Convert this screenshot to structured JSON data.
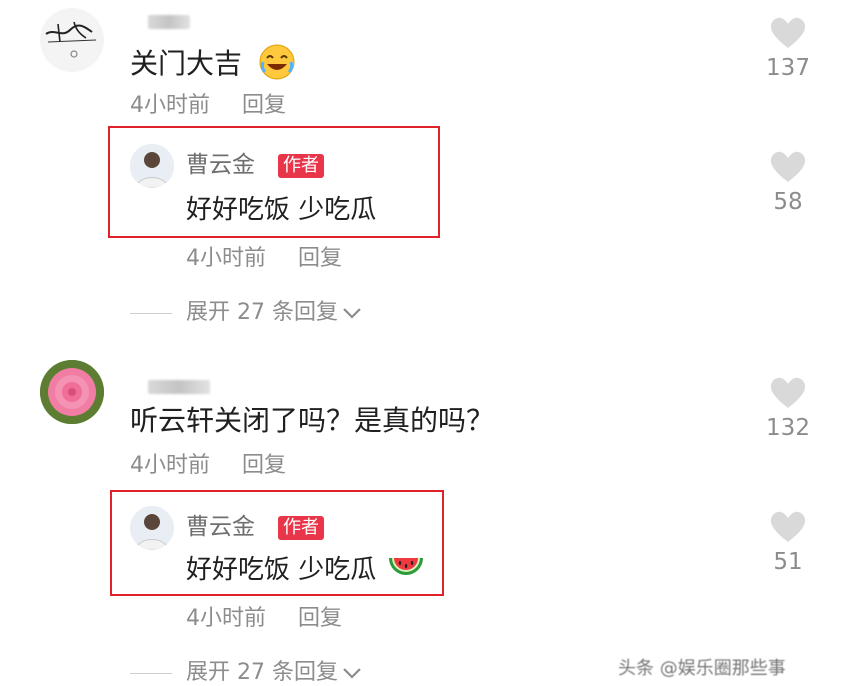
{
  "comments": [
    {
      "text": "关门大吉",
      "time": "4小时前",
      "reply_label": "回复",
      "likes": "137",
      "author_reply": {
        "name": "曹云金",
        "badge": "作者",
        "text": "好好吃饭 少吃瓜",
        "time": "4小时前",
        "reply_label": "回复",
        "likes": "58"
      },
      "expand_label": "展开 27 条回复"
    },
    {
      "text": "听云轩关闭了吗？是真的吗？",
      "time": "4小时前",
      "reply_label": "回复",
      "likes": "132",
      "author_reply": {
        "name": "曹云金",
        "badge": "作者",
        "text": "好好吃饭 少吃瓜",
        "time": "4小时前",
        "reply_label": "回复",
        "likes": "51"
      },
      "expand_label": "展开 27 条回复"
    }
  ],
  "watermark": "头条 @娱乐圈那些事",
  "colors": {
    "highlight_box": "#e0232b",
    "author_badge": "#e9354a",
    "meta_text": "#8c8c8c"
  },
  "icons": [
    "heart-outline-icon",
    "laughing-emoji-icon",
    "watermelon-emoji-icon",
    "chevron-down-icon"
  ]
}
